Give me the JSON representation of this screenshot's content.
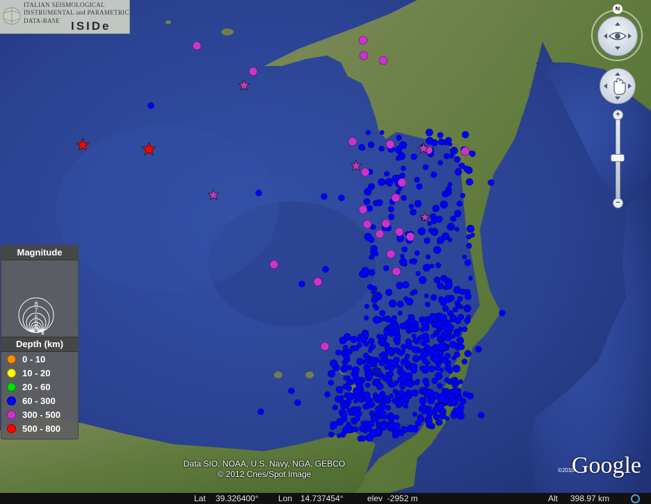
{
  "logo": {
    "line1": "ITALIAN SEISMOLOGICAL",
    "line2": "INSTRUMENTAL and PARAMETRIC",
    "line3": "DATA-BASE",
    "brand": "ISIDe"
  },
  "compass": {
    "north": "N"
  },
  "zoom": {
    "plus": "+",
    "minus": "−"
  },
  "legend": {
    "magnitude_title": "Magnitude",
    "magnitude_labels": [
      "8",
      "7",
      "6",
      "5",
      "4",
      "3",
      "2",
      "1"
    ],
    "depth_title": "Depth (km)",
    "depth_classes": [
      {
        "label": "0 - 10",
        "color": "#ff8c00"
      },
      {
        "label": "10 - 20",
        "color": "#ffff00"
      },
      {
        "label": "20 - 60",
        "color": "#00e000"
      },
      {
        "label": "60 - 300",
        "color": "#0000ff"
      },
      {
        "label": "300 - 500",
        "color": "#cc33cc"
      },
      {
        "label": "500 - 800",
        "color": "#ff0000"
      }
    ]
  },
  "attribution": {
    "line1": "Data SIO, NOAA, U.S. Navy, NGA, GEBCO",
    "line2": "© 2012 Cnes/Spot Image",
    "google": "Google",
    "google_year": "©2010"
  },
  "status_bar": {
    "lat_label": "Lat",
    "lat_value": "39.326400°",
    "lon_label": "Lon",
    "lon_value": "14.737454°",
    "elev": "elev  -2952 m",
    "alt_label": "Alt",
    "alt_value": "398.97 km"
  },
  "colors": {
    "sea": "#2a3f8a",
    "land": "#5f7a3c",
    "blue_events": "#0000ff",
    "magenta_events": "#cc33cc",
    "red_events": "#ff0000"
  }
}
